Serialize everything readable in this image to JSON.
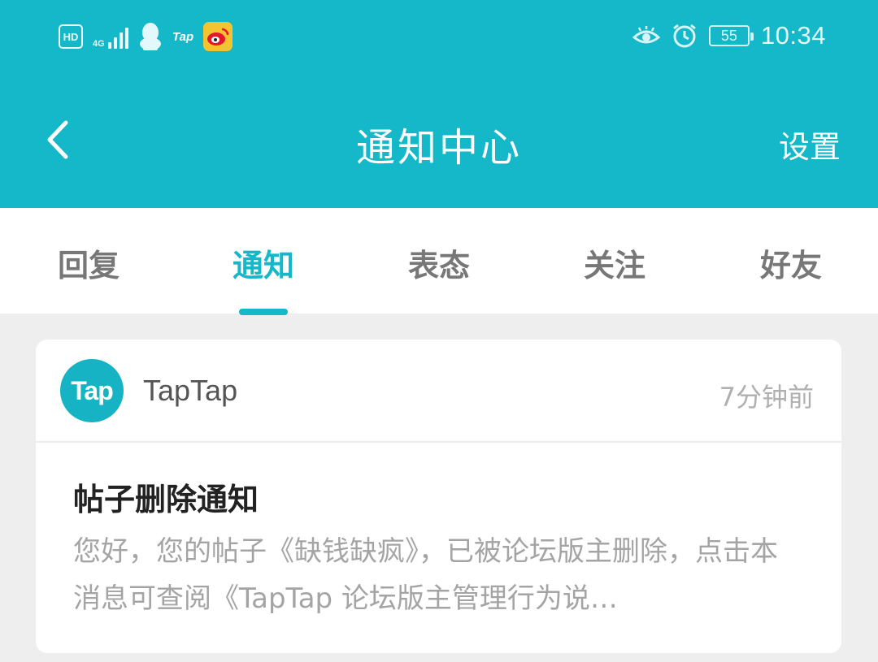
{
  "status_bar": {
    "hd_label": "HD",
    "network_label": "4G",
    "tap_label": "Tap",
    "battery_level": "55",
    "time": "10:34",
    "icons": [
      "hd-icon",
      "signal-icon",
      "qq-icon",
      "taptap-icon",
      "weibo-icon",
      "eye-icon",
      "alarm-icon",
      "battery-icon"
    ]
  },
  "header": {
    "title": "通知中心",
    "settings_label": "设置",
    "background_color": "#14b8c8"
  },
  "tabs": [
    {
      "label": "回复",
      "active": false
    },
    {
      "label": "通知",
      "active": true
    },
    {
      "label": "表态",
      "active": false
    },
    {
      "label": "关注",
      "active": false
    },
    {
      "label": "好友",
      "active": false
    }
  ],
  "notification": {
    "avatar_text": "Tap",
    "sender": "TapTap",
    "time": "7分钟前",
    "title": "帖子删除通知",
    "body": "您好，您的帖子《缺钱缺疯》，已被论坛版主删除，点击本消息可查阅《TapTap 论坛版主管理行为说…"
  }
}
